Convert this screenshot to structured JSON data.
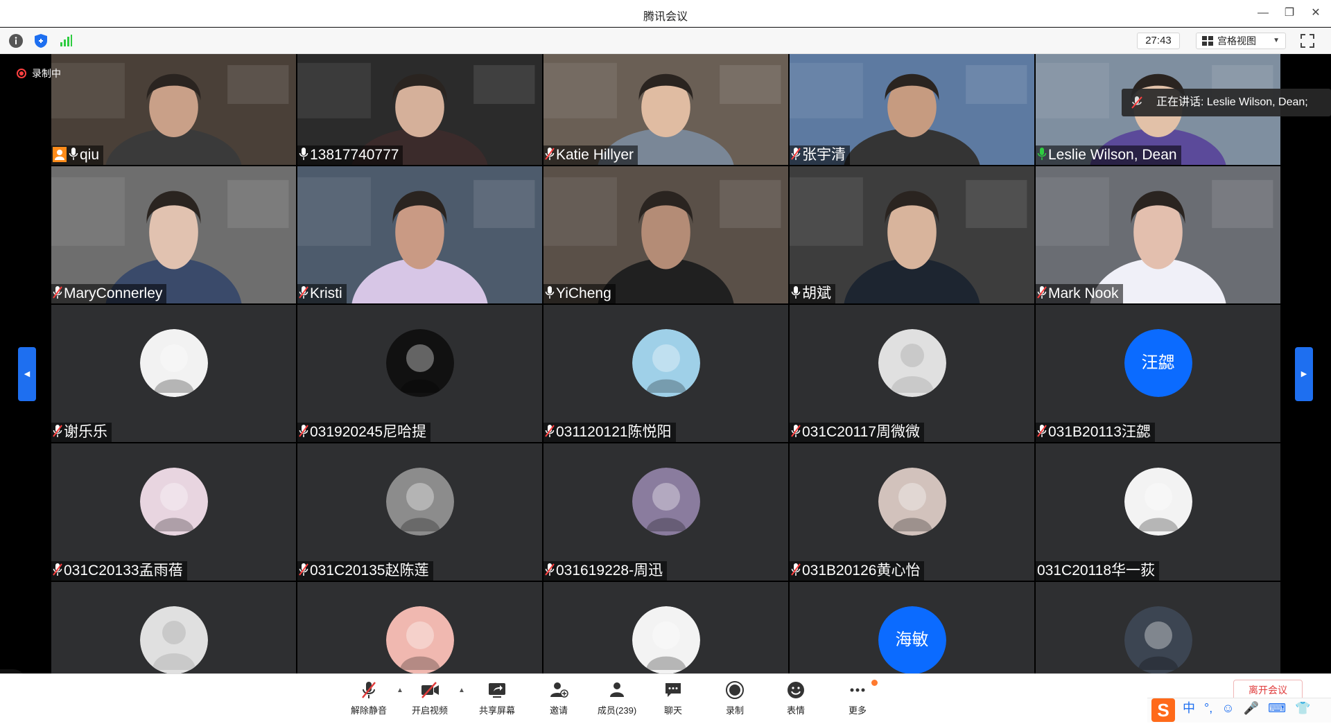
{
  "window": {
    "title": "腾讯会议"
  },
  "topbar": {
    "timer": "27:43",
    "view_label": "宫格视图"
  },
  "recording": {
    "label": "录制中"
  },
  "speaking": {
    "label": "正在讲话: Leslie Wilson, Dean;"
  },
  "participants": [
    {
      "name": "qiu",
      "type": "video",
      "mic": "on",
      "host": true
    },
    {
      "name": "13817740777",
      "type": "video",
      "mic": "on"
    },
    {
      "name": "Katie Hillyer",
      "type": "video",
      "mic": "off"
    },
    {
      "name": "张宇清",
      "type": "video",
      "mic": "off"
    },
    {
      "name": "Leslie Wilson, Dean",
      "type": "video",
      "mic": "speaking"
    },
    {
      "name": "MaryConnerley",
      "type": "video",
      "mic": "off"
    },
    {
      "name": "Kristi",
      "type": "video",
      "mic": "off"
    },
    {
      "name": "YiCheng",
      "type": "video",
      "mic": "on"
    },
    {
      "name": "胡斌",
      "type": "video",
      "mic": "on"
    },
    {
      "name": "Mark Nook",
      "type": "video",
      "mic": "off"
    },
    {
      "name": "谢乐乐",
      "type": "avatar",
      "mic": "off",
      "avatar": "monkey-avatar"
    },
    {
      "name": "031920245尼哈提",
      "type": "avatar",
      "mic": "off",
      "avatar": "angel-statue-avatar"
    },
    {
      "name": "031120121陈悦阳",
      "type": "avatar",
      "mic": "off",
      "avatar": "cat-avatar"
    },
    {
      "name": "031C20117周微微",
      "type": "avatar",
      "mic": "off",
      "avatar": "default-person-avatar"
    },
    {
      "name": "031B20113汪勰",
      "type": "avatar",
      "mic": "off",
      "avatar_text": "汪勰"
    },
    {
      "name": "031C20133孟雨蓓",
      "type": "avatar",
      "mic": "off",
      "avatar": "girl-sunglasses-avatar"
    },
    {
      "name": "031C20135赵陈莲",
      "type": "avatar",
      "mic": "off",
      "avatar": "cartoon-avatar"
    },
    {
      "name": "031619228-周迅",
      "type": "avatar",
      "mic": "off",
      "avatar": "anime-character-avatar"
    },
    {
      "name": "031B20126黄心怡",
      "type": "avatar",
      "mic": "off",
      "avatar": "girl-photo-avatar"
    },
    {
      "name": "031C20118华一荻",
      "type": "avatar",
      "mic": "none",
      "avatar": "alpaca-avatar"
    },
    {
      "name": "",
      "type": "avatar",
      "avatar": "default-person-avatar"
    },
    {
      "name": "",
      "type": "avatar",
      "avatar": "pixel-character-avatar"
    },
    {
      "name": "",
      "type": "avatar",
      "avatar": "husky-avatar"
    },
    {
      "name": "",
      "type": "avatar",
      "avatar_text": "海敏"
    },
    {
      "name": "",
      "type": "avatar",
      "avatar": "forest-photo-avatar"
    }
  ],
  "toolbar": {
    "unmute": "解除静音",
    "start_video": "开启视频",
    "share_screen": "共享屏幕",
    "invite": "邀请",
    "members": "成员(239)",
    "chat": "聊天",
    "record": "录制",
    "reactions": "表情",
    "more": "更多",
    "leave": "离开会议"
  },
  "ime": {
    "mode": "中"
  },
  "colors": {
    "accent": "#1e6ff0",
    "record_red": "#ff4040",
    "mic_on_green": "#2ecc40",
    "tile_bg": "#2e2f31"
  }
}
